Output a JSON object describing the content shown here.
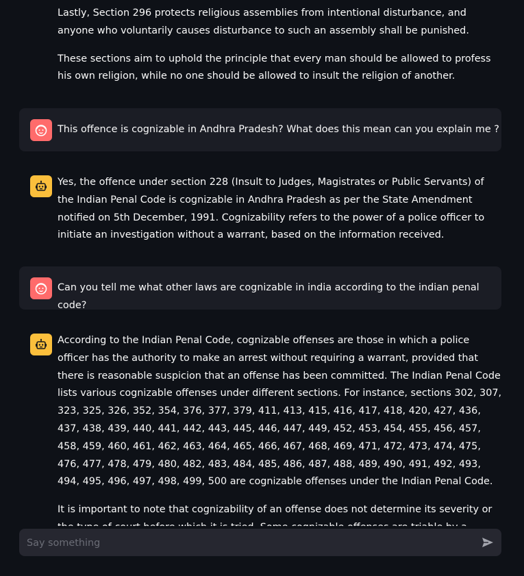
{
  "chat": {
    "continuation": {
      "paragraphs": [
        "Lastly, Section 296 protects religious assemblies from intentional disturbance, and anyone who voluntarily causes disturbance to such an assembly shall be punished.",
        "These sections aim to uphold the principle that every man should be allowed to profess his own religion, while no one should be allowed to insult the religion of another."
      ]
    },
    "messages": [
      {
        "role": "user",
        "avatar_icon": "user-face-icon",
        "text": "This offence is cognizable in Andhra Pradesh? What does this mean can you explain me ?"
      },
      {
        "role": "assistant",
        "avatar_icon": "robot-icon",
        "text": "Yes, the offence under section 228 (Insult to Judges, Magistrates or Public Servants) of the Indian Penal Code is cognizable in Andhra Pradesh as per the State Amendment notified on 5th December, 1991. Cognizability refers to the power of a police officer to initiate an investigation without a warrant, based on the information received."
      },
      {
        "role": "user",
        "avatar_icon": "user-face-icon",
        "text": "Can you tell me what other laws are cognizable in india according to the indian penal code?"
      },
      {
        "role": "assistant",
        "avatar_icon": "robot-icon",
        "paragraphs": [
          "According to the Indian Penal Code, cognizable offenses are those in which a police officer has the authority to make an arrest without requiring a warrant, provided that there is reasonable suspicion that an offense has been committed. The Indian Penal Code lists various cognizable offenses under different sections. For instance, sections 302, 307, 323, 325, 326, 352, 354, 376, 377, 379, 411, 413, 415, 416, 417, 418, 420, 427, 436, 437, 438, 439, 440, 441, 442, 443, 445, 446, 447, 449, 452, 453, 454, 455, 456, 457, 458, 459, 460, 461, 462, 463, 464, 465, 466, 467, 468, 469, 471, 472, 473, 474, 475, 476, 477, 478, 479, 480, 482, 483, 484, 485, 486, 487, 488, 489, 490, 491, 492, 493, 494, 495, 496, 497, 498, 499, 500 are cognizable offenses under the Indian Penal Code.",
          "It is important to note that cognizability of an offense does not determine its severity or the type of court before which it is tried. Some cognizable offenses are triable by a Magistrate's Court,"
        ]
      }
    ]
  },
  "input": {
    "placeholder": "Say something",
    "value": "",
    "send_icon": "send-icon"
  },
  "colors": {
    "background": "#0e1117",
    "user_bubble": "#1b1d25",
    "user_avatar": "#ff6b6b",
    "assistant_avatar": "#fbbf3c",
    "input_background": "#262730",
    "text": "#fafafa"
  }
}
